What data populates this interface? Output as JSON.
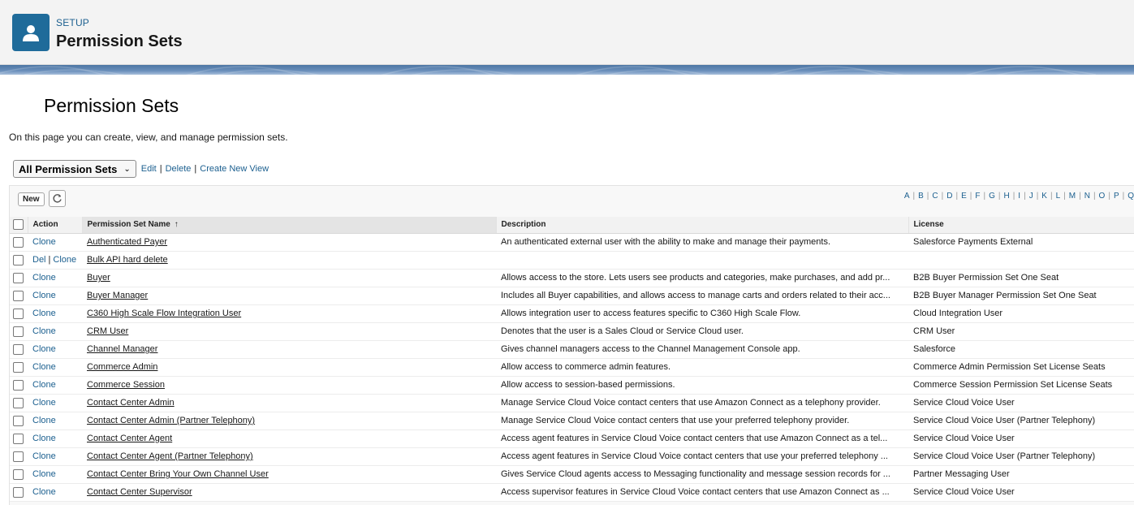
{
  "header": {
    "breadcrumb": "SETUP",
    "title": "Permission Sets",
    "icon": "user-icon",
    "brand_color": "#1f6b9a"
  },
  "page": {
    "heading": "Permission Sets",
    "description": "On this page you can create, view, and manage permission sets."
  },
  "view": {
    "selected": "All Permission Sets",
    "links": [
      "Edit",
      "Delete",
      "Create New View"
    ]
  },
  "toolbar": {
    "new_label": "New",
    "alphabet": [
      "A",
      "B",
      "C",
      "D",
      "E",
      "F",
      "G",
      "H",
      "I",
      "J",
      "K",
      "L",
      "M",
      "N",
      "O",
      "P",
      "Q"
    ]
  },
  "table": {
    "columns": [
      "Action",
      "Permission Set Name",
      "Description",
      "License"
    ],
    "sorted_column": "Permission Set Name",
    "rows": [
      {
        "actions": [
          "Clone"
        ],
        "name": "Authenticated Payer",
        "description": "An authenticated external user with the ability to make and manage their payments.",
        "license": "Salesforce Payments External"
      },
      {
        "actions": [
          "Del",
          "Clone"
        ],
        "name": "Bulk API hard delete",
        "description": "",
        "license": ""
      },
      {
        "actions": [
          "Clone"
        ],
        "name": "Buyer",
        "description": "Allows access to the store. Lets users see products and categories, make purchases, and add pr...",
        "license": "B2B Buyer Permission Set One Seat"
      },
      {
        "actions": [
          "Clone"
        ],
        "name": "Buyer Manager",
        "description": "Includes all Buyer capabilities, and allows access to manage carts and orders related to their acc...",
        "license": "B2B Buyer Manager Permission Set One Seat"
      },
      {
        "actions": [
          "Clone"
        ],
        "name": "C360 High Scale Flow Integration User",
        "description": "Allows integration user to access features specific to C360 High Scale Flow.",
        "license": "Cloud Integration User"
      },
      {
        "actions": [
          "Clone"
        ],
        "name": "CRM User",
        "description": "Denotes that the user is a Sales Cloud or Service Cloud user.",
        "license": "CRM User"
      },
      {
        "actions": [
          "Clone"
        ],
        "name": "Channel Manager",
        "description": "Gives channel managers access to the Channel Management Console app.",
        "license": "Salesforce"
      },
      {
        "actions": [
          "Clone"
        ],
        "name": "Commerce Admin",
        "description": "Allow access to commerce admin features.",
        "license": "Commerce Admin Permission Set License Seats"
      },
      {
        "actions": [
          "Clone"
        ],
        "name": "Commerce Session",
        "description": "Allow access to session-based permissions.",
        "license": "Commerce Session Permission Set License Seats"
      },
      {
        "actions": [
          "Clone"
        ],
        "name": "Contact Center Admin",
        "description": "Manage Service Cloud Voice contact centers that use Amazon Connect as a telephony provider.",
        "license": "Service Cloud Voice User"
      },
      {
        "actions": [
          "Clone"
        ],
        "name": "Contact Center Admin (Partner Telephony)",
        "description": "Manage Service Cloud Voice contact centers that use your preferred telephony provider.",
        "license": "Service Cloud Voice User (Partner Telephony)"
      },
      {
        "actions": [
          "Clone"
        ],
        "name": "Contact Center Agent",
        "description": "Access agent features in Service Cloud Voice contact centers that use Amazon Connect as a tel...",
        "license": "Service Cloud Voice User"
      },
      {
        "actions": [
          "Clone"
        ],
        "name": "Contact Center Agent (Partner Telephony)",
        "description": "Access agent features in Service Cloud Voice contact centers that use your preferred telephony ...",
        "license": "Service Cloud Voice User (Partner Telephony)"
      },
      {
        "actions": [
          "Clone"
        ],
        "name": "Contact Center Bring Your Own Channel User",
        "description": "Gives Service Cloud agents access to Messaging functionality and message session records for ...",
        "license": "Partner Messaging User"
      },
      {
        "actions": [
          "Clone"
        ],
        "name": "Contact Center Supervisor",
        "description": "Access supervisor features in Service Cloud Voice contact centers that use Amazon Connect as ...",
        "license": "Service Cloud Voice User"
      }
    ]
  }
}
